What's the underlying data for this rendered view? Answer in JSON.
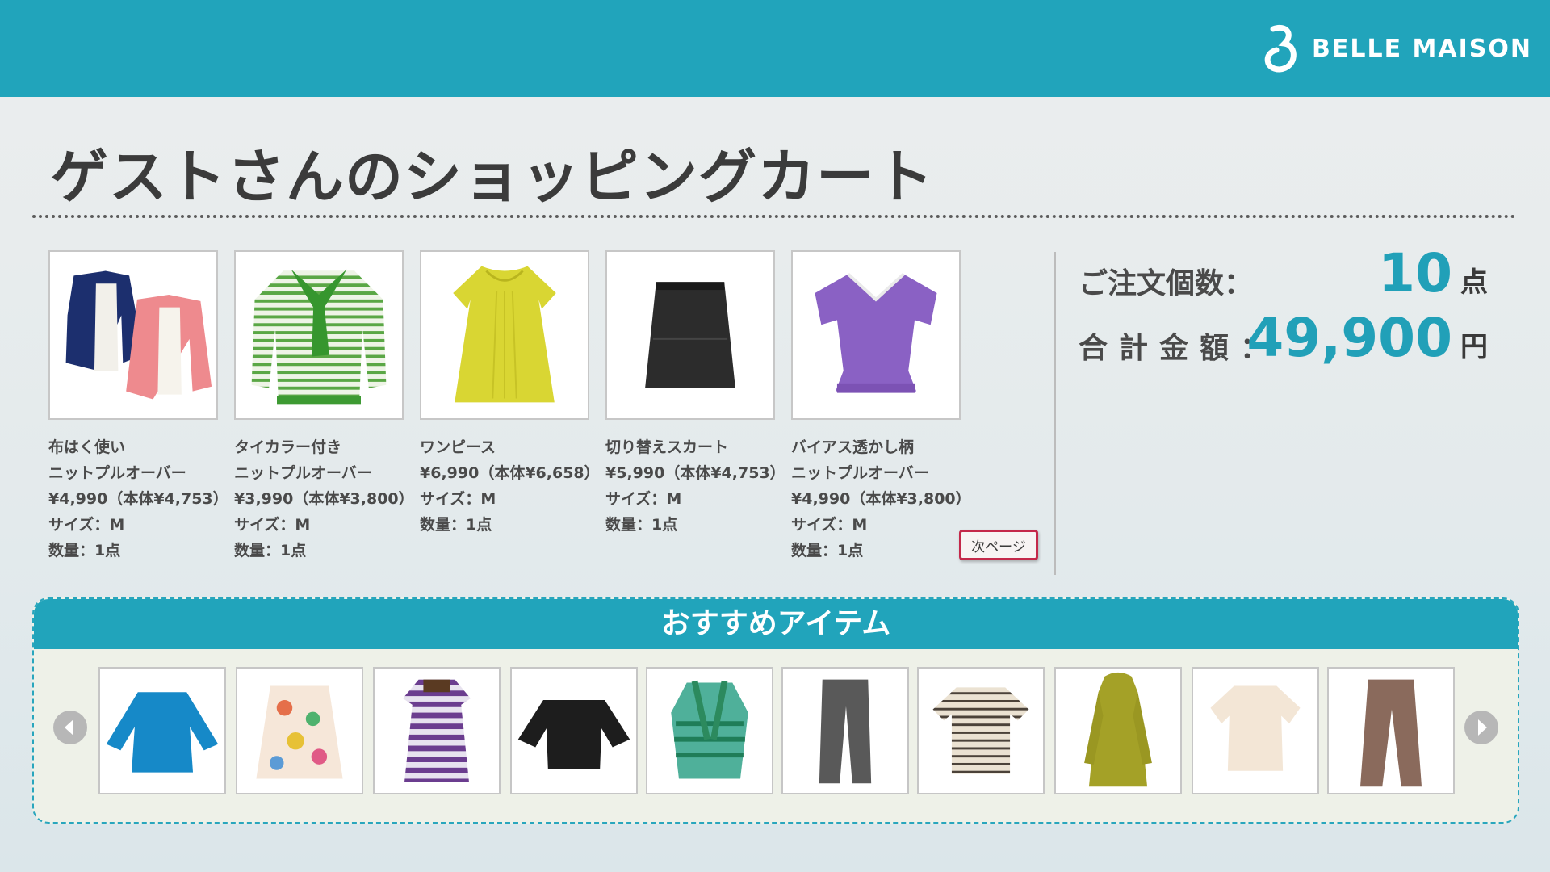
{
  "brand": {
    "name": "BELLE MAISON",
    "logo_icon": "belle-maison-b-logo"
  },
  "page": {
    "title": "ゲストさんのショッピングカート"
  },
  "cart": {
    "items": [
      {
        "lines": [
          "布はく使い",
          "ニットプルオーバー",
          "¥4,990（本体¥4,753）",
          "サイズ：M",
          "数量：1点"
        ],
        "image": "navy-pink-cardigan-pair"
      },
      {
        "lines": [
          "タイカラー付き",
          "ニットプルオーバー",
          "¥3,990（本体¥3,800）",
          "サイズ：M",
          "数量：1点"
        ],
        "image": "green-stripe-tie-collar-knit"
      },
      {
        "lines": [
          "ワンピース",
          "¥6,990（本体¥6,658）",
          "サイズ：M",
          "数量：1点"
        ],
        "image": "yellow-dress"
      },
      {
        "lines": [
          "切り替えスカート",
          "¥5,990（本体¥4,753）",
          "サイズ：M",
          "数量：1点"
        ],
        "image": "black-skirt"
      },
      {
        "lines": [
          "バイアス透かし柄",
          "ニットプルオーバー",
          "¥4,990（本体¥3,800）",
          "サイズ：M",
          "数量：1点"
        ],
        "image": "purple-knit-top"
      }
    ],
    "next_page_label": "次ページ"
  },
  "summary": {
    "count_label": "ご注文個数：",
    "count_value": "10",
    "count_unit": "点",
    "total_label": "合計金額：",
    "total_value": "49,900",
    "total_unit": "円",
    "accent_color": "#21a0b8"
  },
  "recommended": {
    "title": "おすすめアイテム",
    "prev_icon": "chevron-left-icon",
    "next_icon": "chevron-right-icon",
    "items": [
      {
        "image": "blue-blouse"
      },
      {
        "image": "floral-skirt"
      },
      {
        "image": "purple-stripe-dress"
      },
      {
        "image": "black-top"
      },
      {
        "image": "green-pattern-tunic"
      },
      {
        "image": "gray-pants"
      },
      {
        "image": "striped-polo"
      },
      {
        "image": "olive-hooded-coat"
      },
      {
        "image": "cream-knit-top"
      },
      {
        "image": "brown-pants"
      }
    ]
  },
  "colors": {
    "header": "#21a4bb",
    "next_button_border": "#c4284a"
  }
}
